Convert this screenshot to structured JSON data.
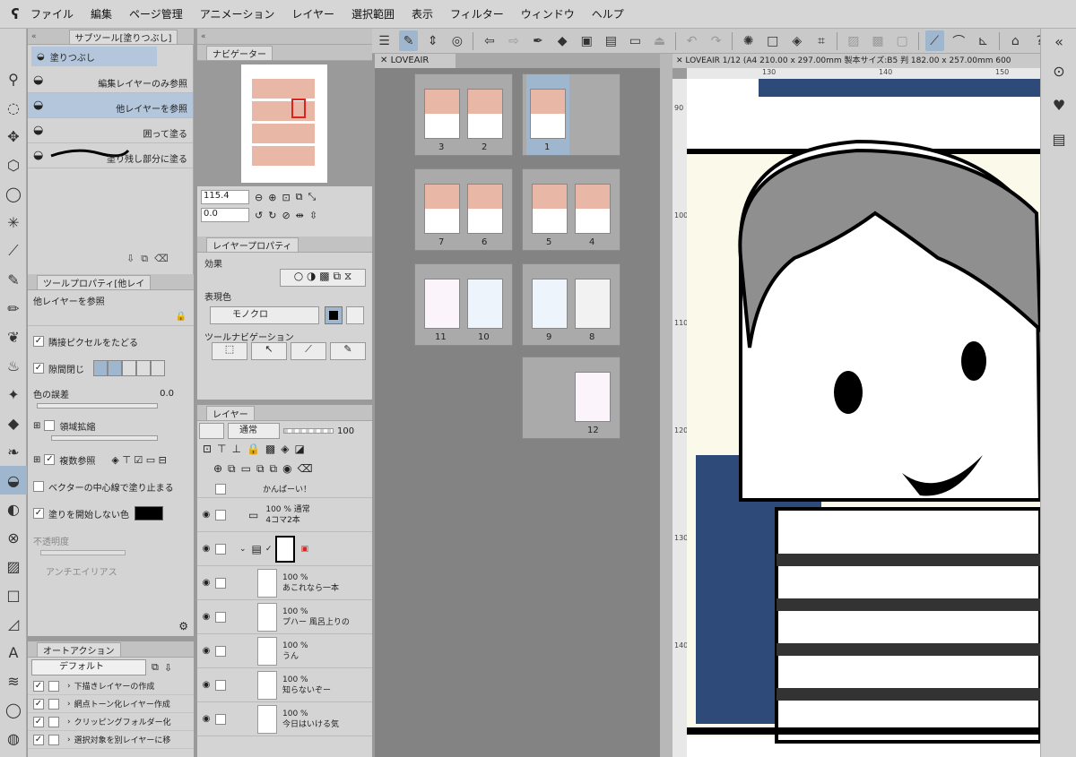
{
  "menubar": {
    "items": [
      "ファイル",
      "編集",
      "ページ管理",
      "アニメーション",
      "レイヤー",
      "選択範囲",
      "表示",
      "フィルター",
      "ウィンドウ",
      "ヘルプ"
    ]
  },
  "subtool": {
    "tab_label": "サブツール[塗りつぶし]",
    "group_label": "塗りつぶし",
    "items": [
      "編集レイヤーのみ参照",
      "他レイヤーを参照",
      "囲って塗る",
      "塗り残し部分に塗る"
    ]
  },
  "toolprop": {
    "tab_label": "ツールプロパティ[他レイ",
    "current": "他レイヤーを参照",
    "options": {
      "adjacent": "隣接ピクセルをたどる",
      "gap": "隙間閉じ",
      "color_margin": "色の誤差",
      "color_margin_value": "0.0",
      "area_scaling": "領域拡縮",
      "multi_ref": "複数参照",
      "vector_center": "ベクターの中心線で塗り止まる",
      "no_start_color": "塗りを開始しない色",
      "opacity": "不透明度",
      "antialias": "アンチエイリアス"
    }
  },
  "autoaction": {
    "tab_label": "オートアクション",
    "set": "デフォルト",
    "items": [
      "下描きレイヤーの作成",
      "網点トーン化レイヤー作成",
      "クリッピングフォルダー化",
      "選択対象を別レイヤーに移"
    ]
  },
  "navigator": {
    "tab_label": "ナビゲーター",
    "zoom": "115.4",
    "rotation": "0.0"
  },
  "layerprop": {
    "tab_label": "レイヤープロパティ",
    "effect": "効果",
    "expression": "表現色",
    "color_mode": "モノクロ",
    "toolnav": "ツールナビゲーション"
  },
  "layers": {
    "tab_label": "レイヤー",
    "blend": "通常",
    "opacity": "100",
    "rows": [
      {
        "name": "かんぱーい！",
        "meta": ""
      },
      {
        "name": "4コマ2本",
        "meta": "100 % 通常"
      },
      {
        "name": "あこれなら一本",
        "meta": "100 %"
      },
      {
        "name": "プハー 風呂上りの",
        "meta": "100 %"
      },
      {
        "name": "うん",
        "meta": "100 %"
      },
      {
        "name": "知らないぞー",
        "meta": "100 %"
      },
      {
        "name": "今日はいける気",
        "meta": "100 %"
      }
    ]
  },
  "pages": {
    "tab_label": "LOVEAIR",
    "numbers": [
      "3",
      "2",
      "1",
      "7",
      "6",
      "5",
      "4",
      "11",
      "10",
      "9",
      "8",
      "12"
    ]
  },
  "canvas": {
    "tab_label": "LOVEAIR 1/12 (A4 210.00 x 297.00mm 製本サイズ:B5 判 182.00 x 257.00mm 600",
    "ruler_h": [
      "130",
      "140",
      "150"
    ],
    "ruler_v": [
      "90",
      "100",
      "110",
      "120",
      "130",
      "140"
    ]
  }
}
